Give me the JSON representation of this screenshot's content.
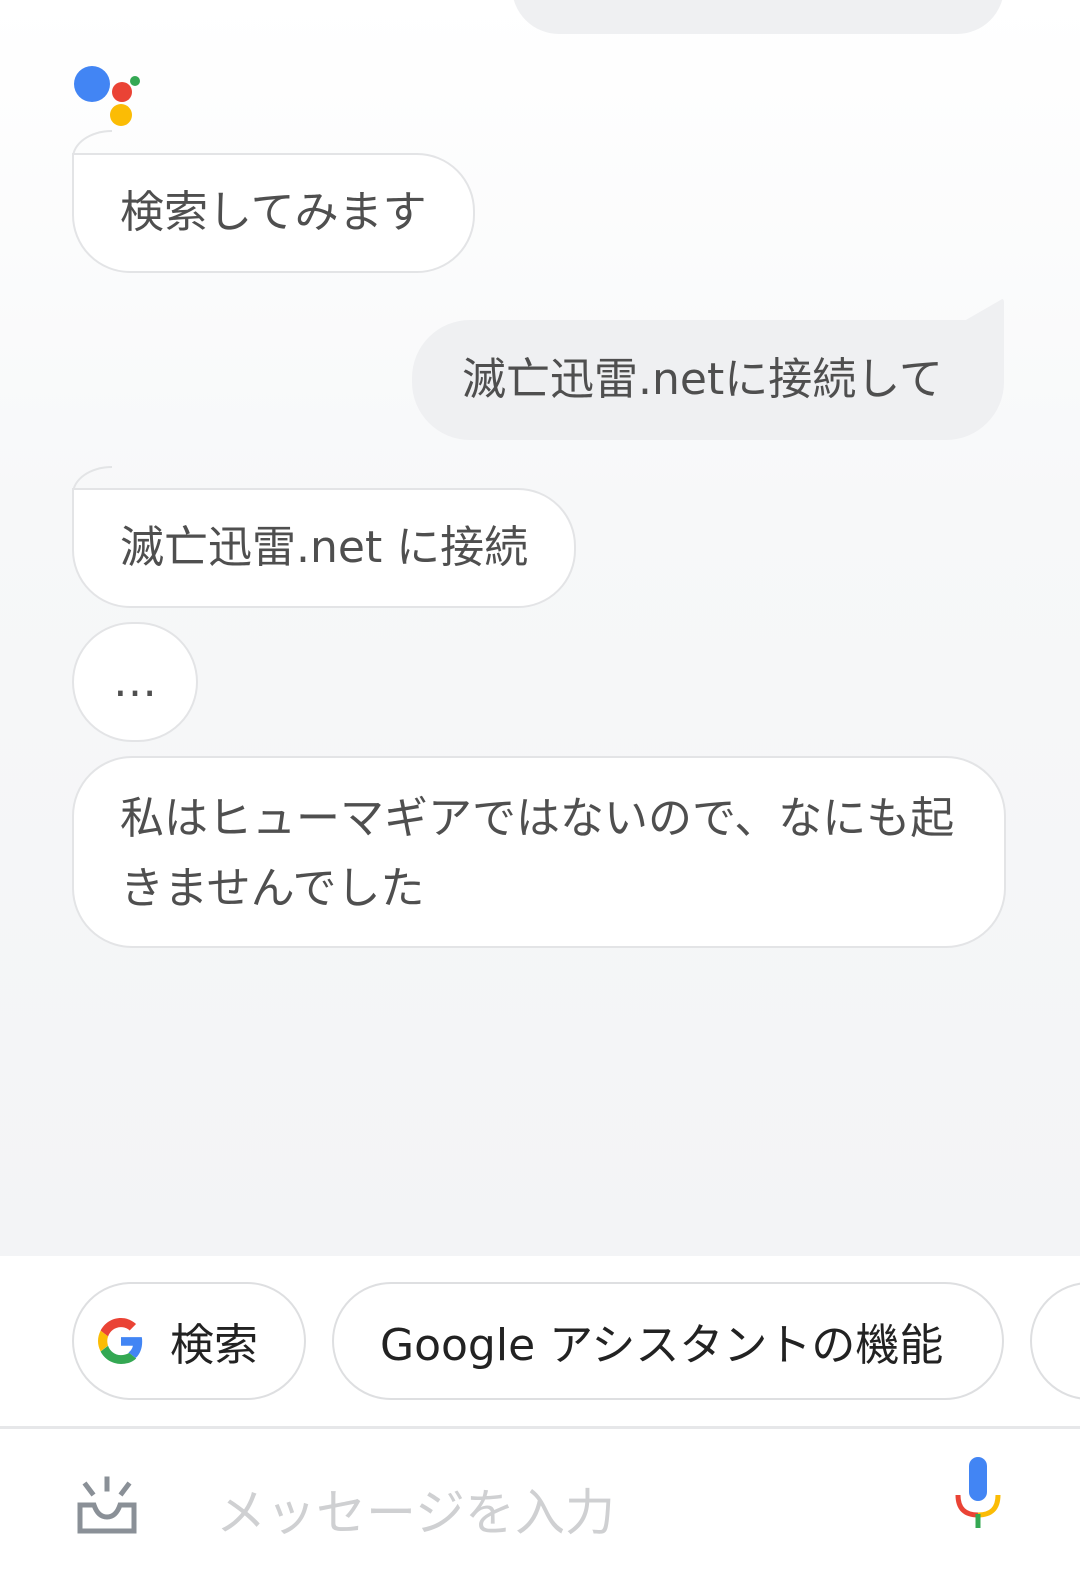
{
  "conversation": {
    "messages": [
      {
        "role": "assistant",
        "text": "検索してみます"
      },
      {
        "role": "user",
        "text": "滅亡迅雷.netに接続して"
      },
      {
        "role": "assistant",
        "text": "滅亡迅雷.net に接続"
      },
      {
        "role": "assistant",
        "text": "…"
      },
      {
        "role": "assistant",
        "text": "私はヒューマギアではないので、なにも起きませんでした"
      }
    ]
  },
  "suggestions": {
    "chips": [
      {
        "label": "検索",
        "icon": "google-g-icon"
      },
      {
        "label": "Google アシスタントの機能"
      }
    ]
  },
  "input": {
    "placeholder": "メッセージを入力",
    "left_icon": "snapshot-tray-icon",
    "right_icon": "microphone-icon"
  },
  "colors": {
    "google_blue": "#4285F4",
    "google_red": "#EA4335",
    "google_yellow": "#FBBC05",
    "google_green": "#34A853",
    "user_bubble": "#EFF0F2",
    "assistant_border": "#E3E4E6",
    "text": "#4F4F4F",
    "placeholder": "#CFD0D2"
  }
}
